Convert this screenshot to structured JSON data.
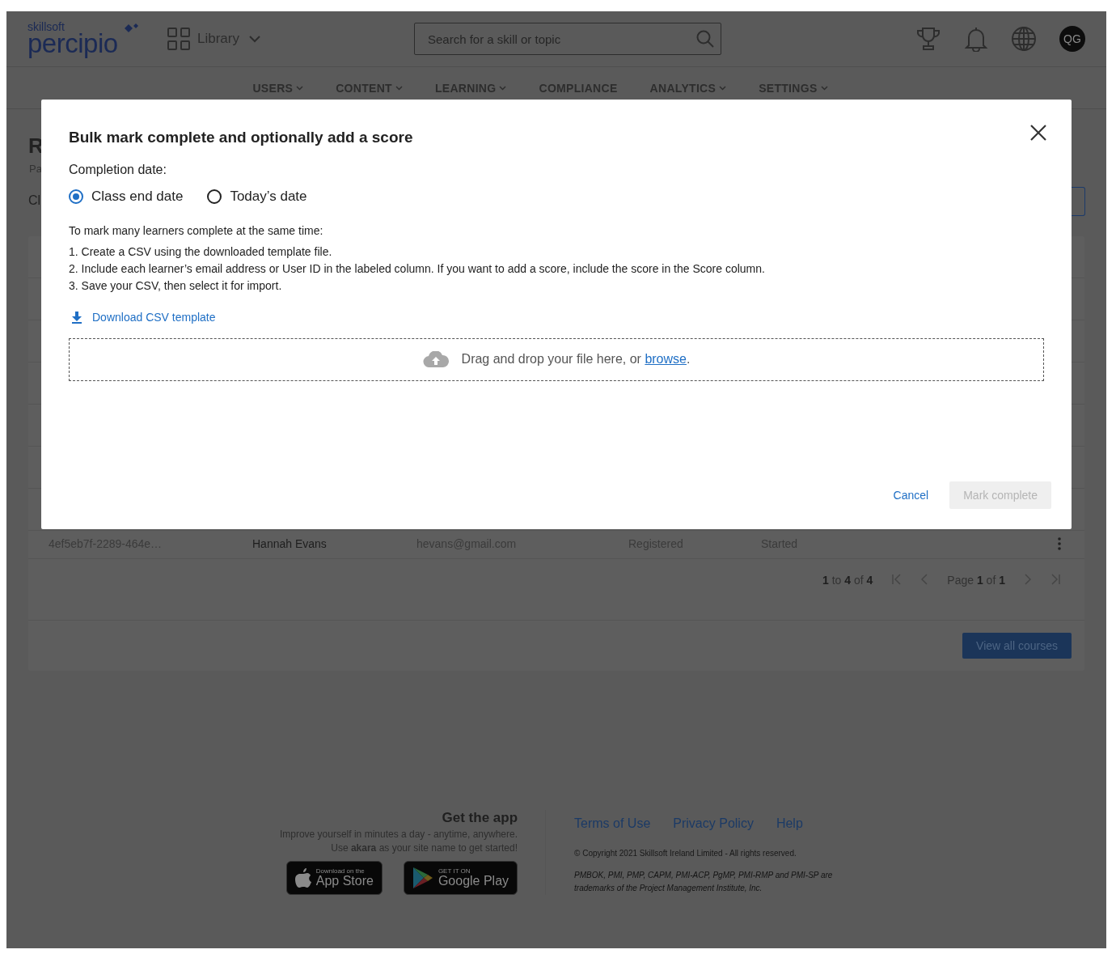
{
  "header": {
    "logo_top": "skillsoft",
    "logo_main": "percipio",
    "library_label": "Library",
    "search": {
      "placeholder": "Search for a skill or topic"
    },
    "avatar_initials": "QG"
  },
  "nav": [
    {
      "label": "USERS",
      "has_menu": true
    },
    {
      "label": "CONTENT",
      "has_menu": true
    },
    {
      "label": "LEARNING",
      "has_menu": true
    },
    {
      "label": "COMPLIANCE",
      "has_menu": false
    },
    {
      "label": "ANALYTICS",
      "has_menu": true
    },
    {
      "label": "SETTINGS",
      "has_menu": true
    }
  ],
  "page": {
    "title_fragment": "R",
    "subtitle_fragment": "Pa",
    "tab_fragment": "Cl"
  },
  "table": {
    "rows": [
      {
        "cells": [
          "4ef5eb7f-2289-464e…",
          "Hannah Evans",
          "hevans@gmail.com",
          "Registered",
          "Started"
        ]
      }
    ]
  },
  "pagination": {
    "range": "**1** to **4** of **4**",
    "page": "Page **1** of **1**"
  },
  "view_all_button": "View all courses",
  "footer": {
    "app_title": "Get the app",
    "app_lines": [
      "Improve yourself in minutes a day - anytime, anywhere.",
      "Use **akara** as your site name to get started!"
    ],
    "badges": [
      {
        "kind": "apple",
        "small": "Download on the",
        "big": "App Store"
      },
      {
        "kind": "google",
        "small": "GET IT ON",
        "big": "Google Play"
      }
    ],
    "links": [
      "Terms of Use",
      "Privacy Policy",
      "Help"
    ],
    "copyright": "© Copyright 2021 Skillsoft Ireland Limited - All rights reserved.",
    "trademark": "PMBOK, PMI, PMP, CAPM, PMI-ACP, PgMP, PMI-RMP and PMI-SP are trademarks of the Project Management Institute, Inc."
  },
  "modal": {
    "title": "Bulk mark complete and optionally add a score",
    "date_label": "Completion date:",
    "date_options": [
      {
        "label": "Class end date",
        "selected": true
      },
      {
        "label": "Today’s date",
        "selected": false
      }
    ],
    "intro": "To mark many learners complete at the same time:",
    "steps": [
      "1. Create a CSV using the downloaded template file.",
      "2. Include each learner’s email address or User ID in the labeled column. If you want to add a score, include the score in the Score column.",
      "3. Save your CSV, then select it for import."
    ],
    "download_link": "Download CSV template",
    "dropzone": {
      "text": "Drag and drop your file here, or ",
      "link": "browse",
      "suffix": "."
    },
    "cancel": "Cancel",
    "submit": {
      "label": "Mark complete",
      "disabled": true
    }
  }
}
